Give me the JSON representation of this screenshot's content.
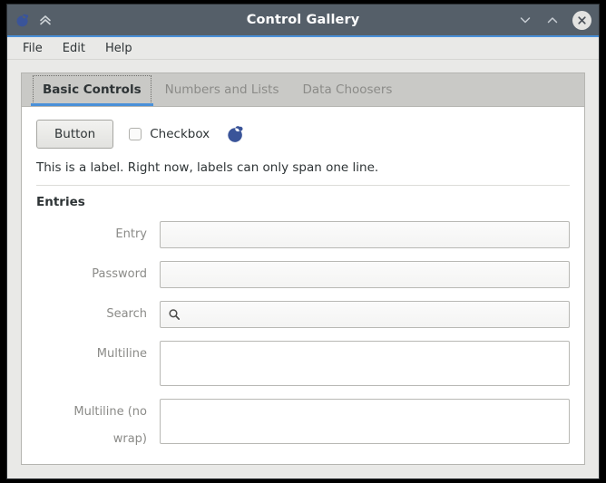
{
  "window": {
    "title": "Control Gallery",
    "titlebar_icons": {
      "app_logo": "libui-logo-icon",
      "collapse": "double-chevron-up-icon",
      "minimize": "chevron-down-icon",
      "maximize": "chevron-up-icon",
      "close": "close-circle-icon"
    },
    "colors": {
      "titlebar": "#555f69",
      "titlebar_accent": "#4a90d9",
      "tab_accent": "#4a90d9",
      "logo_blue": "#3a5499",
      "window_bg": "#e9e9e7",
      "tabstrip_bg": "#c9c9c6",
      "page_bg": "#ffffff"
    }
  },
  "menubar": {
    "items": [
      {
        "label": "File"
      },
      {
        "label": "Edit"
      },
      {
        "label": "Help"
      }
    ]
  },
  "tabs": [
    {
      "label": "Basic Controls",
      "active": true
    },
    {
      "label": "Numbers and Lists",
      "active": false
    },
    {
      "label": "Data Choosers",
      "active": false
    }
  ],
  "basic_controls": {
    "button_label": "Button",
    "checkbox_label": "Checkbox",
    "checkbox_checked": false,
    "logo_icon": "libui-logo-icon",
    "label_text": "This is a label. Right now, labels can only span one line.",
    "group_title": "Entries",
    "entries": [
      {
        "label": "Entry",
        "value": "",
        "placeholder": "",
        "type": "entry"
      },
      {
        "label": "Password",
        "value": "",
        "placeholder": "",
        "type": "password"
      },
      {
        "label": "Search",
        "value": "",
        "placeholder": "",
        "type": "search",
        "icon": "search-icon"
      },
      {
        "label": "Multiline",
        "value": "",
        "placeholder": "",
        "type": "multiline"
      },
      {
        "label": "Multiline (no wrap)",
        "value": "",
        "placeholder": "",
        "type": "multiline-nowrap"
      }
    ]
  }
}
